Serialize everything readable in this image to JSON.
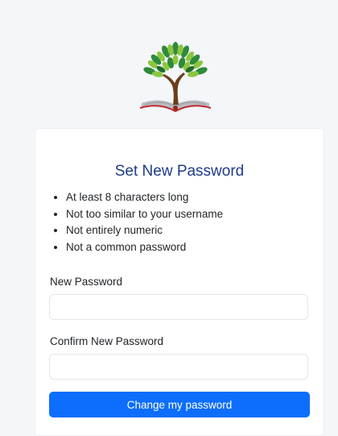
{
  "logo": {
    "icon": "tree-on-book-logo"
  },
  "form": {
    "title": "Set New Password",
    "rules": [
      "At least 8 characters long",
      "Not too similar to your username",
      "Not entirely numeric",
      "Not a common password"
    ],
    "new_password_label": "New Password",
    "new_password_value": "",
    "confirm_password_label": "Confirm New Password",
    "confirm_password_value": "",
    "submit_label": "Change my password"
  },
  "colors": {
    "page_background": "#f4f6f9",
    "title": "#1e3a8a",
    "button": "#0d6efd",
    "button_text": "#ffffff"
  }
}
